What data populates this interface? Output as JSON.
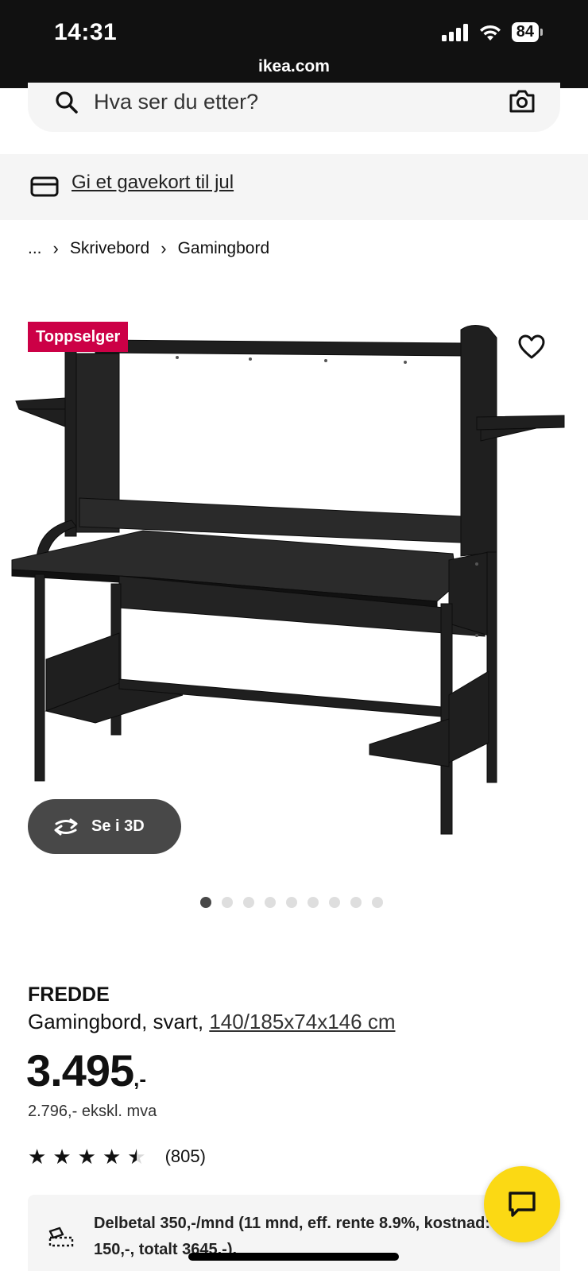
{
  "status_bar": {
    "time": "14:31",
    "battery": "84"
  },
  "browser": {
    "url": "ikea.com"
  },
  "search": {
    "placeholder": "Hva ser du etter?"
  },
  "gift_banner": {
    "link_text": "Gi et gavekort til jul"
  },
  "breadcrumb": {
    "ellipsis": "...",
    "separator": "›",
    "items": [
      "Skrivebord",
      "Gamingbord"
    ]
  },
  "product": {
    "badge": "Toppselger",
    "view_3d_label": "Se i 3D",
    "gallery": {
      "image_count": 9,
      "active_index": 0
    },
    "brand": "FREDDE",
    "description": "Gamingbord, svart, ",
    "dimensions": "140/185x74x146 cm",
    "price_main": "3.495",
    "price_suffix": ",-",
    "price_ex_vat": "2.796,- ekskl. mva",
    "rating": {
      "stars": 4.5,
      "count_text": "(805)"
    }
  },
  "financing": {
    "text": "Delbetal 350,-/mnd (11 mnd, eff. rente 8.9%, kostnad: 150,-, totalt 3645,-)."
  },
  "colors": {
    "badge": "#cc0046",
    "chat_button": "#fbd914",
    "status_bar": "#111111",
    "button_3d": "#484848"
  }
}
